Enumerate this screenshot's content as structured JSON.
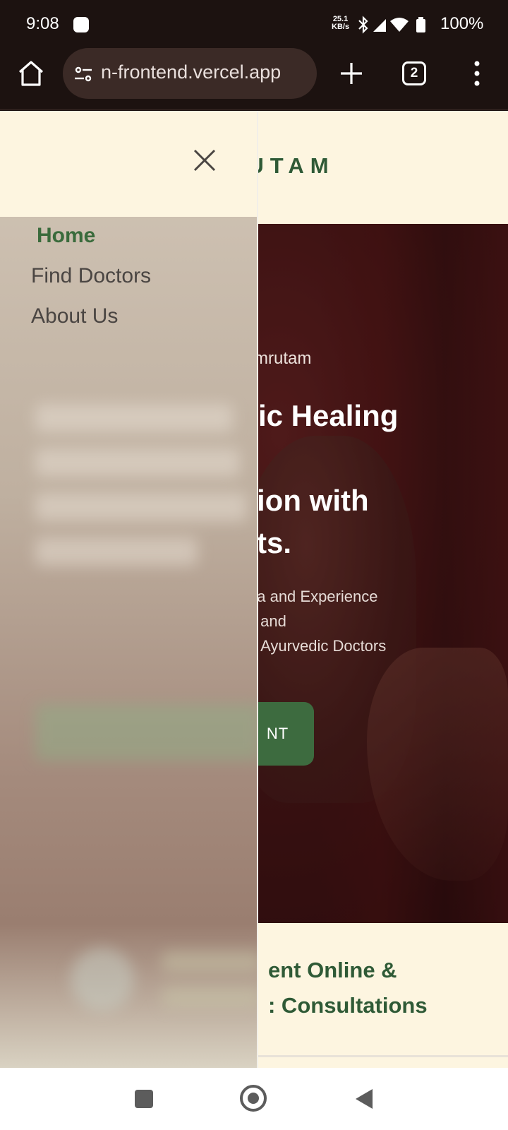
{
  "status_bar": {
    "time": "9:08",
    "net_speed_top": "25.1",
    "net_speed_bottom": "KB/s",
    "battery": "100%"
  },
  "browser": {
    "url": "n-frontend.vercel.app",
    "tab_count": "2"
  },
  "site": {
    "logo": "RUTAM"
  },
  "drawer": {
    "items": [
      {
        "label": "Home",
        "active": true
      },
      {
        "label": "Find Doctors",
        "active": false
      },
      {
        "label": "About Us",
        "active": false
      }
    ]
  },
  "hero": {
    "eyebrow": "mrutam",
    "title_line1": "tic Healing",
    "title_line3": "ion with",
    "title_line4": "ts.",
    "sub_line1": "da and Experience",
    "sub_line2": "s and",
    "sub_line3": "d Ayurvedic Doctors",
    "cta": "NT"
  },
  "consult": {
    "line1": "ent Online &",
    "line2": ": Consultations"
  },
  "colors": {
    "brand_green": "#3d6b3f",
    "cream": "#fdf5e0",
    "maroon": "#4a1718"
  }
}
